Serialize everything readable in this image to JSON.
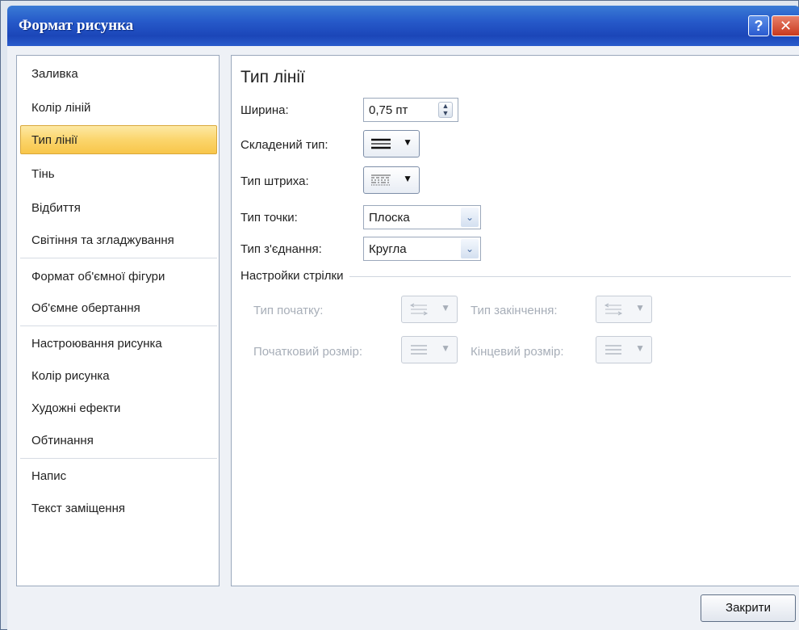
{
  "window": {
    "title": "Формат рисунка",
    "help_glyph": "?",
    "close_glyph": "✕"
  },
  "nav": {
    "items": [
      {
        "label": "Заливка",
        "active": false
      },
      {
        "label": "Колір ліній",
        "active": false
      },
      {
        "label": "Тип лінії",
        "active": true
      },
      {
        "label": "Тінь",
        "active": false
      },
      {
        "label": "Відбиття",
        "active": false
      },
      {
        "label": "Світіння та згладжування",
        "active": false
      },
      {
        "label": "Формат об'ємної фігури",
        "active": false
      },
      {
        "label": "Об'ємне обертання",
        "active": false
      },
      {
        "label": "Настроювання рисунка",
        "active": false
      },
      {
        "label": "Колір рисунка",
        "active": false
      },
      {
        "label": "Художні ефекти",
        "active": false
      },
      {
        "label": "Обтинання",
        "active": false
      },
      {
        "label": "Напис",
        "active": false
      },
      {
        "label": "Текст заміщення",
        "active": false
      }
    ]
  },
  "main": {
    "section_title": "Тип лінії",
    "width_label": "Ширина:",
    "width_value": "0,75 пт",
    "compound_label": "Складений тип:",
    "dash_label": "Тип штриха:",
    "cap_label": "Тип точки:",
    "cap_value": "Плоска",
    "join_label": "Тип з'єднання:",
    "join_value": "Кругла",
    "arrow_group_title": "Настройки стрілки",
    "begin_type_label": "Тип початку:",
    "end_type_label": "Тип закінчення:",
    "begin_size_label": "Початковий розмір:",
    "end_size_label": "Кінцевий розмір:"
  },
  "footer": {
    "close_label": "Закрити"
  },
  "icons": {
    "caret": "▼",
    "combo_arrow": "⌄",
    "spin_up": "▲",
    "spin_down": "▼"
  },
  "colors": {
    "titlebar": "#2659c9",
    "active_item": "#fbd56c",
    "disabled_text": "#a7aeb8"
  }
}
